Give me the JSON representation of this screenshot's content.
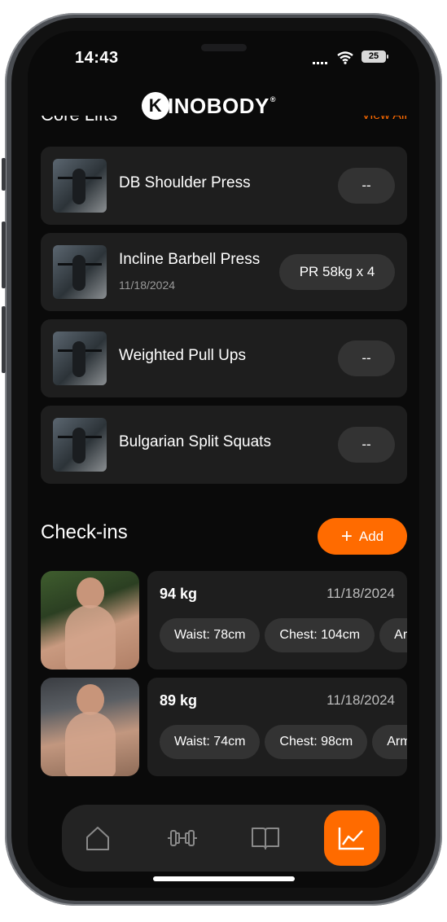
{
  "status_bar": {
    "time": "14:43",
    "battery": "25"
  },
  "brand": {
    "logo_letter": "K",
    "logo_rest": "INOBODY",
    "registered": "®"
  },
  "core_lifts": {
    "title": "Core Lifts",
    "view_all": "View All",
    "items": [
      {
        "name": "DB Shoulder Press",
        "date": "",
        "record": "--"
      },
      {
        "name": "Incline Barbell Press",
        "date": "11/18/2024",
        "record": "PR 58kg x 4"
      },
      {
        "name": "Weighted Pull Ups",
        "date": "",
        "record": "--"
      },
      {
        "name": "Bulgarian Split Squats",
        "date": "",
        "record": "--"
      }
    ]
  },
  "checkins": {
    "title": "Check-ins",
    "add_label": "Add",
    "items": [
      {
        "weight": "94 kg",
        "date": "11/18/2024",
        "chips": [
          "Waist: 78cm",
          "Chest: 104cm",
          "Arms"
        ]
      },
      {
        "weight": "89 kg",
        "date": "11/18/2024",
        "chips": [
          "Waist: 74cm",
          "Chest: 98cm",
          "Arms"
        ]
      }
    ]
  },
  "nav": {
    "items": [
      {
        "icon": "home-icon",
        "active": false
      },
      {
        "icon": "dumbbell-icon",
        "active": false
      },
      {
        "icon": "book-icon",
        "active": false
      },
      {
        "icon": "chart-icon",
        "active": true
      }
    ]
  },
  "colors": {
    "accent": "#ff6b00",
    "card": "#1e1e1e",
    "pill": "#333333",
    "background": "#0a0a0a"
  }
}
